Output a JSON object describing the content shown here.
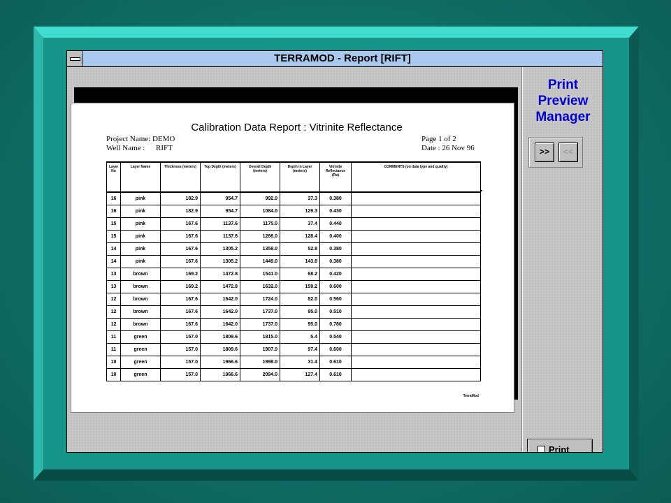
{
  "window": {
    "title": "TERRAMOD - Report [RIFT]"
  },
  "side_panel": {
    "title_lines": [
      "Print",
      "Preview",
      "Manager"
    ],
    "next_label": ">>",
    "prev_label": "<<",
    "print_label": "Print"
  },
  "report": {
    "title": "Calibration Data Report : Vitrinite Reflectance",
    "project_label": "Project Name: DEMO",
    "well_label": "Well Name :",
    "well_value": "RIFT",
    "page_label": "Page 1 of 2",
    "date_label": "Date : 26 Nov 96",
    "footer_mark": "TerraMod",
    "columns": [
      "Layer No",
      "Layer Name",
      "Thickness (meters)",
      "Top Depth (meters)",
      "Overall Depth (meters)",
      "Depth in Layer (meters)",
      "Vitrinite Reflectance (Ro)",
      "COMMENTS (on data type and quality)"
    ],
    "rows": [
      [
        "16",
        "pink",
        "182.9",
        "954.7",
        "992.0",
        "37.3",
        "0.380",
        ""
      ],
      [
        "16",
        "pink",
        "182.9",
        "954.7",
        "1084.0",
        "129.3",
        "0.430",
        ""
      ],
      [
        "15",
        "pink",
        "167.6",
        "1137.6",
        "1175.0",
        "37.4",
        "0.440",
        ""
      ],
      [
        "15",
        "pink",
        "167.6",
        "1137.6",
        "1266.0",
        "128.4",
        "0.400",
        ""
      ],
      [
        "14",
        "pink",
        "167.6",
        "1305.2",
        "1358.0",
        "52.8",
        "0.380",
        ""
      ],
      [
        "14",
        "pink",
        "167.6",
        "1305.2",
        "1449.0",
        "143.8",
        "0.380",
        ""
      ],
      [
        "13",
        "brown",
        "169.2",
        "1472.8",
        "1541.0",
        "68.2",
        "0.420",
        ""
      ],
      [
        "13",
        "brown",
        "169.2",
        "1472.8",
        "1632.0",
        "159.2",
        "0.600",
        ""
      ],
      [
        "12",
        "brown",
        "167.6",
        "1642.0",
        "1724.0",
        "82.0",
        "0.560",
        ""
      ],
      [
        "12",
        "brown",
        "167.6",
        "1642.0",
        "1737.0",
        "95.0",
        "0.510",
        ""
      ],
      [
        "12",
        "brown",
        "167.6",
        "1642.0",
        "1737.0",
        "95.0",
        "0.780",
        ""
      ],
      [
        "11",
        "green",
        "157.0",
        "1809.6",
        "1815.0",
        "5.4",
        "0.540",
        ""
      ],
      [
        "11",
        "green",
        "157.0",
        "1809.6",
        "1907.0",
        "97.4",
        "0.600",
        ""
      ],
      [
        "10",
        "green",
        "157.0",
        "1966.6",
        "1998.0",
        "31.4",
        "0.610",
        ""
      ],
      [
        "10",
        "green",
        "157.0",
        "1966.6",
        "2094.0",
        "127.4",
        "0.610",
        ""
      ]
    ]
  }
}
